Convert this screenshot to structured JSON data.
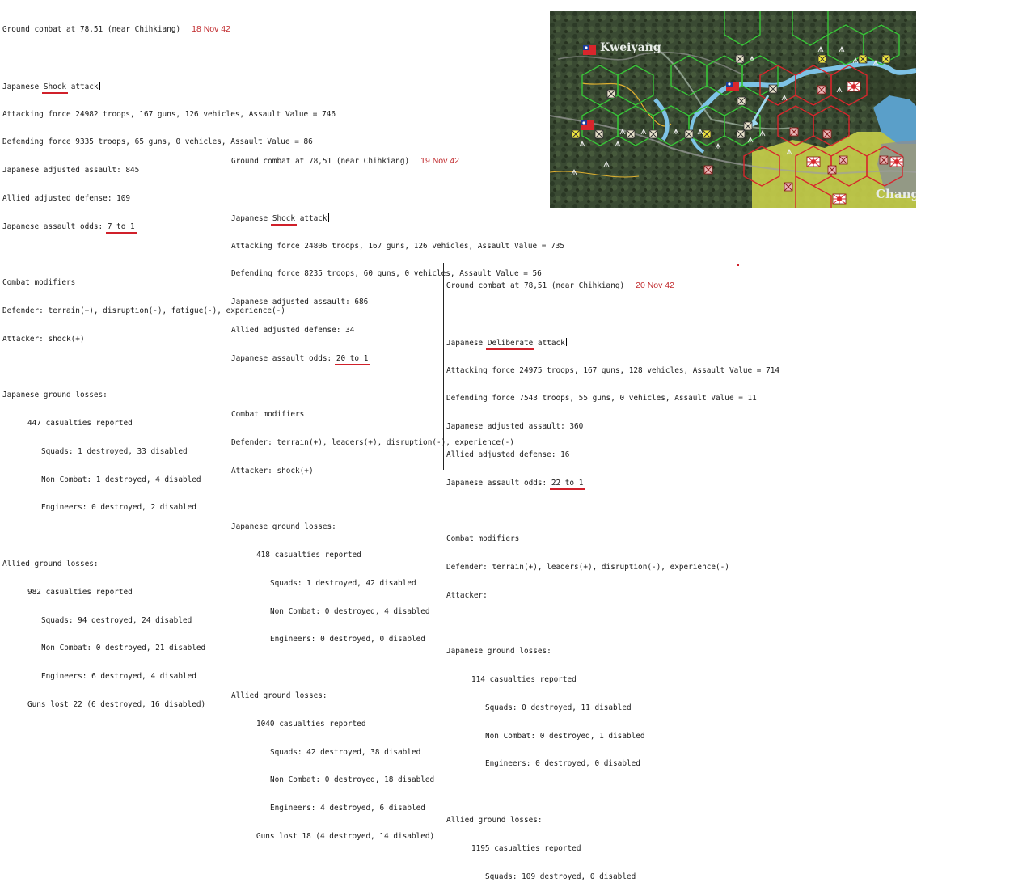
{
  "reports": [
    {
      "title": "Ground combat at 78,51 (near Chihkiang)",
      "date": "18 Nov 42",
      "attack_prefix": "Japanese ",
      "attack_type": "Shock",
      "attack_suffix": " attack",
      "attacking_force": "Attacking force 24982 troops, 167 guns, 126 vehicles, Assault Value = 746",
      "defending_force": "Defending force 9335 troops, 65 guns, 0 vehicles, Assault Value = 86",
      "adjusted_assault": "Japanese adjusted assault: 845",
      "adjusted_defense": "Allied adjusted defense: 109",
      "odds_prefix": "Japanese assault odds: ",
      "odds_value": "7 to 1",
      "modifiers_header": "Combat modifiers",
      "defender_mods": "Defender: terrain(+), disruption(-), fatigue(-), experience(-)",
      "attacker_mods": "Attacker: shock(+)",
      "jp_losses_header": "Japanese ground losses:",
      "jp_casualties": "447 casualties reported",
      "jp_squads": "Squads: 1 destroyed, 33 disabled",
      "jp_noncombat": "Non Combat: 1 destroyed, 4 disabled",
      "jp_engineers": "Engineers: 0 destroyed, 2 disabled",
      "al_losses_header": "Allied ground losses:",
      "al_casualties": "982 casualties reported",
      "al_squads": "Squads: 94 destroyed, 24 disabled",
      "al_noncombat": "Non Combat: 0 destroyed, 21 disabled",
      "al_engineers": "Engineers: 6 destroyed, 4 disabled",
      "al_guns": "Guns lost 22 (6 destroyed, 16 disabled)"
    },
    {
      "title": "Ground combat at 78,51 (near Chihkiang)",
      "date": "19 Nov 42",
      "attack_prefix": "Japanese ",
      "attack_type": "Shock",
      "attack_suffix": " attack",
      "attacking_force": "Attacking force 24806 troops, 167 guns, 126 vehicles, Assault Value = 735",
      "defending_force": "Defending force 8235 troops, 60 guns, 0 vehicles, Assault Value = 56",
      "adjusted_assault": "Japanese adjusted assault: 686",
      "adjusted_defense": "Allied adjusted defense: 34",
      "odds_prefix": "Japanese assault odds: ",
      "odds_value": "20 to 1",
      "modifiers_header": "Combat modifiers",
      "defender_mods": "Defender: terrain(+), leaders(+), disruption(-), experience(-)",
      "attacker_mods": "Attacker: shock(+)",
      "jp_losses_header": "Japanese ground losses:",
      "jp_casualties": "418 casualties reported",
      "jp_squads": "Squads: 1 destroyed, 42 disabled",
      "jp_noncombat": "Non Combat: 0 destroyed, 4 disabled",
      "jp_engineers": "Engineers: 0 destroyed, 0 disabled",
      "al_losses_header": "Allied ground losses:",
      "al_casualties": "1040 casualties reported",
      "al_squads": "Squads: 42 destroyed, 38 disabled",
      "al_noncombat": "Non Combat: 0 destroyed, 18 disabled",
      "al_engineers": "Engineers: 4 destroyed, 6 disabled",
      "al_guns": "Guns lost 18 (4 destroyed, 14 disabled)"
    },
    {
      "title": "Ground combat at 78,51 (near Chihkiang)",
      "date": "20 Nov 42",
      "attack_prefix": "Japanese ",
      "attack_type": "Deliberate",
      "attack_suffix": " attack",
      "attacking_force": "Attacking force 24975 troops, 167 guns, 128 vehicles, Assault Value = 714",
      "defending_force": "Defending force 7543 troops, 55 guns, 0 vehicles, Assault Value = 11",
      "adjusted_assault": "Japanese adjusted assault: 360",
      "adjusted_defense": "Allied adjusted defense: 16",
      "odds_prefix": "Japanese assault odds: ",
      "odds_value": "22 to 1",
      "modifiers_header": "Combat modifiers",
      "defender_mods": "Defender: terrain(+), leaders(+), disruption(-), experience(-)",
      "attacker_mods": "Attacker:",
      "jp_losses_header": "Japanese ground losses:",
      "jp_casualties": "114 casualties reported",
      "jp_squads": "Squads: 0 destroyed, 11 disabled",
      "jp_noncombat": "Non Combat: 0 destroyed, 1 disabled",
      "jp_engineers": "Engineers: 0 destroyed, 0 disabled",
      "al_losses_header": "Allied ground losses:",
      "al_casualties": "1195 casualties reported",
      "al_squads": "Squads: 109 destroyed, 0 disabled"
    }
  ],
  "map": {
    "label_kweiyang": "Kweiyang",
    "label_chang": "Chang",
    "colors": {
      "terrain": "#3d4a35",
      "river": "#7ec3e6",
      "lake": "#5a9fc9",
      "allied_hex": "#38c438",
      "japanese_hex": "#d8262c",
      "clear_terrain": "#c8cf4a"
    }
  }
}
